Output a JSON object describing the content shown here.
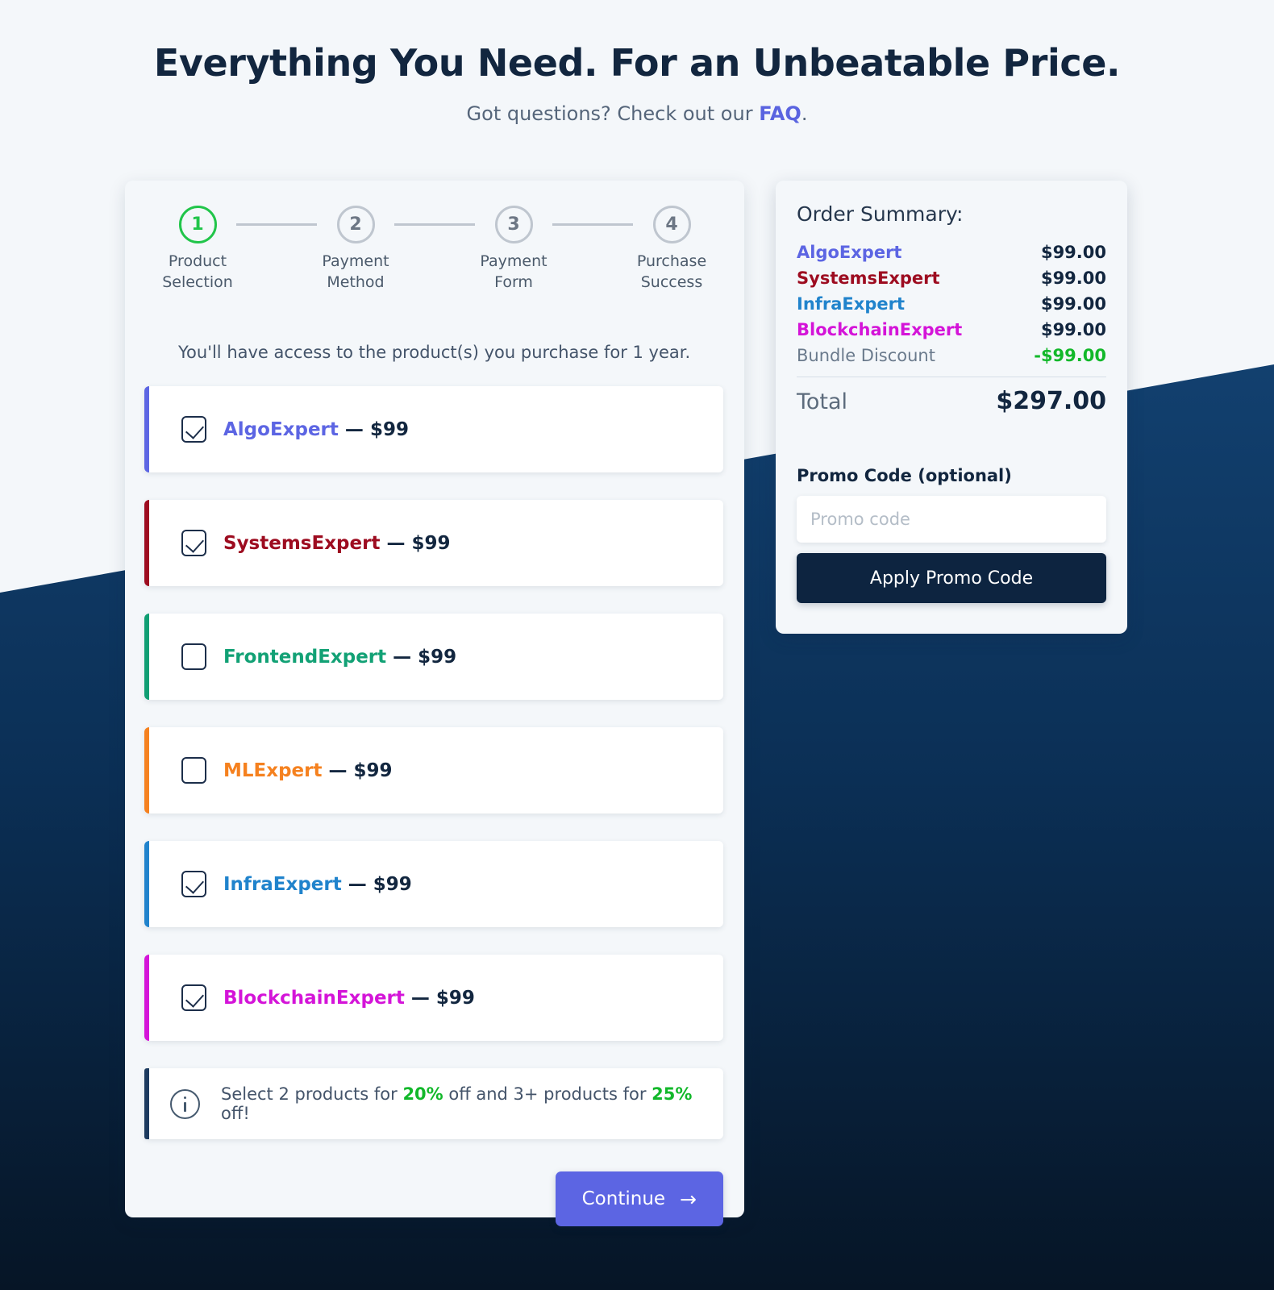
{
  "hero": {
    "title": "Everything You Need. For an Unbeatable Price.",
    "subtitle_before": "Got questions? Check out our ",
    "faq_label": "FAQ",
    "subtitle_after": "."
  },
  "theme": {
    "page_bg": "#f4f7fa",
    "navy_top": "#12406f",
    "navy_bottom": "#061526",
    "accent_indigo": "#5c65e3",
    "accent_green": "#12b82a",
    "dark_navy": "#0d2440"
  },
  "stepper": {
    "steps": [
      {
        "number": "1",
        "label": "Product\nSelection",
        "state": "active"
      },
      {
        "number": "2",
        "label": "Payment\nMethod",
        "state": "inactive"
      },
      {
        "number": "3",
        "label": "Payment\nForm",
        "state": "inactive"
      },
      {
        "number": "4",
        "label": "Purchase\nSuccess",
        "state": "inactive"
      }
    ]
  },
  "main": {
    "access_note": "You'll have access to the product(s) you purchase for 1 year.",
    "products": [
      {
        "name": "AlgoExpert",
        "dash": "—",
        "price": "$99",
        "checked": true,
        "color": "#5c65e3",
        "accent": "#5c65e3"
      },
      {
        "name": "SystemsExpert",
        "dash": "—",
        "price": "$99",
        "checked": true,
        "color": "#9d0c20",
        "accent": "#9d0c20"
      },
      {
        "name": "FrontendExpert",
        "dash": "—",
        "price": "$99",
        "checked": false,
        "color": "#12a175",
        "accent": "#0f9e72"
      },
      {
        "name": "MLExpert",
        "dash": "—",
        "price": "$99",
        "checked": false,
        "color": "#f5811f",
        "accent": "#f5811f"
      },
      {
        "name": "InfraExpert",
        "dash": "—",
        "price": "$99",
        "checked": true,
        "color": "#2083cc",
        "accent": "#2083cc"
      },
      {
        "name": "BlockchainExpert",
        "dash": "—",
        "price": "$99",
        "checked": true,
        "color": "#d414d8",
        "accent": "#d414d8"
      }
    ],
    "info_banner": {
      "icon": "info-circle-icon",
      "text_1": "Select 2 products for ",
      "pct_1": "20%",
      "text_2": " off and 3+ products for ",
      "pct_2": "25%",
      "text_3": " off!"
    },
    "continue_label": "Continue",
    "continue_icon": "arrow-right-icon"
  },
  "summary": {
    "title": "Order Summary:",
    "lines": [
      {
        "name": "AlgoExpert",
        "amount": "$99.00",
        "color": "#5c65e3",
        "type": "product"
      },
      {
        "name": "SystemsExpert",
        "amount": "$99.00",
        "color": "#9d0c20",
        "type": "product"
      },
      {
        "name": "InfraExpert",
        "amount": "$99.00",
        "color": "#2083cc",
        "type": "product"
      },
      {
        "name": "BlockchainExpert",
        "amount": "$99.00",
        "color": "#d414d8",
        "type": "product"
      },
      {
        "name": "Bundle Discount",
        "amount": "-$99.00",
        "color": "#6a7a8c",
        "type": "discount"
      }
    ],
    "total_label": "Total",
    "total_amount": "$297.00",
    "promo_label": "Promo Code (optional)",
    "promo_placeholder": "Promo code",
    "promo_value": "",
    "promo_button": "Apply Promo Code"
  }
}
